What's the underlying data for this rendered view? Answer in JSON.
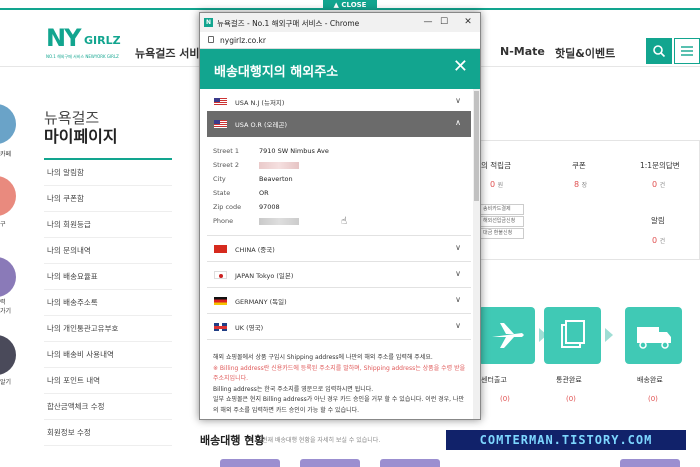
{
  "site": {
    "close_label": "CLOSE",
    "logo": {
      "main": "NY",
      "sub_word": "GIRLZ",
      "tagline": "NO.1 해외구매 서비스 NEWYORK GIRLZ"
    },
    "nav": [
      "뉴욕걸즈 서비스",
      "N-Mate",
      "핫딜&이벤트"
    ],
    "search_icon": "search-icon",
    "menu_icon": "hamburger-icon"
  },
  "sidebar_left": {
    "labels": [
      "카페",
      "구",
      "력\n가기",
      "알기"
    ]
  },
  "mypage": {
    "title_line1": "뉴욕걸즈",
    "title_line2": "마이페이지",
    "menu": [
      "나의 알림함",
      "나의 쿠폰함",
      "나의 회원등급",
      "나의 문의내역",
      "나의 배송요율표",
      "나의 배송주소록",
      "나의 개인통관고유부호",
      "나의 배송비 사용내역",
      "나의 포인트 내역",
      "합산금액체크 수정",
      "회원정보 수정"
    ]
  },
  "stats": {
    "items": [
      {
        "label": "의 적립금",
        "value": "0",
        "unit": "원"
      },
      {
        "label": "쿠폰",
        "value": "8",
        "unit": "장"
      },
      {
        "label": "1:1문의답변",
        "value": "0",
        "unit": "건"
      },
      {
        "label": "알림",
        "value": "0",
        "unit": "건"
      }
    ],
    "mini_list": [
      "송비카드결제",
      "해외선입금신청",
      "대금 환불신청"
    ]
  },
  "steps": {
    "items": [
      {
        "label": "센터출고",
        "count": "(0)"
      },
      {
        "label": "통관완료",
        "count": "(0)"
      },
      {
        "label": "배송완료",
        "count": "(0)"
      }
    ]
  },
  "bottom": {
    "title": "배송대행 현황",
    "desc": "현재 배송대행 현황을 자세히 보실 수 있습니다."
  },
  "watermark": "COMTERMAN.TISTORY.COM",
  "popup": {
    "window_title": "뉴욕걸즈 - No.1 해외구매 서비스 - Chrome",
    "url": "nygirlz.co.kr",
    "modal_title": "배송대행지의 해외주소",
    "countries": [
      {
        "name": "USA N.J (뉴저지)",
        "flag": "us",
        "active": false
      },
      {
        "name": "USA O.R (오레곤)",
        "flag": "us",
        "active": true
      },
      {
        "name": "CHINA (중국)",
        "flag": "cn",
        "active": false
      },
      {
        "name": "JAPAN Tokyo (일본)",
        "flag": "jp",
        "active": false
      },
      {
        "name": "GERMANY (독일)",
        "flag": "de",
        "active": false
      },
      {
        "name": "UK (영국)",
        "flag": "uk",
        "active": false
      }
    ],
    "address": {
      "street1_label": "Street 1",
      "street1": "7910 SW Nimbus Ave",
      "street2_label": "Street 2",
      "city_label": "City",
      "city": "Beaverton",
      "state_label": "State",
      "state": "OR",
      "zip_label": "Zip code",
      "zip": "97008",
      "phone_label": "Phone"
    },
    "notes": [
      "해외 쇼핑몰에서 상품 구입시 Shipping address에 나만의 해외 주소를 입력해 주세요.",
      "※ Billing address란 신용카드에 등록된 주소지를 말하며, Shipping address는 상품을 수령 받을 주소지입니다.",
      "Billing address는 한국 주소지를 영문으로 입력하시면 됩니다.",
      "일부 쇼핑몰은 현지 Billing address가 아닌 경우 카드 승인을 거부 할 수 있습니다. 이런 경우, 나만의 해외 주소를 입력하면 카드 승인이 가능 할 수 있습니다."
    ]
  }
}
